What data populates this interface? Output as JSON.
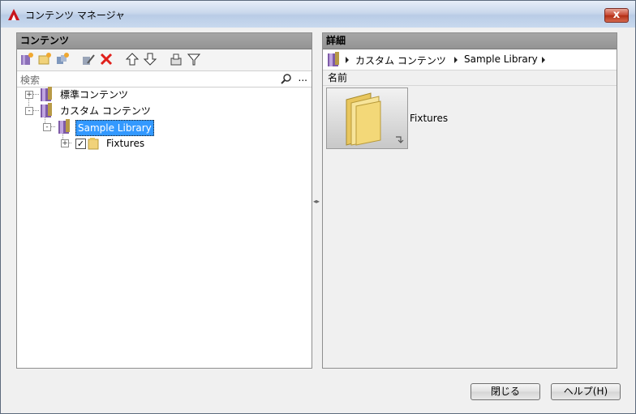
{
  "window": {
    "title": "コンテンツ マネージャ",
    "close_glyph": "x"
  },
  "contents_panel": {
    "header": "コンテンツ",
    "search_placeholder": "検索",
    "search_more": "...",
    "tree": [
      {
        "label": "標準コンテンツ",
        "expander": "+"
      },
      {
        "label": "カスタム コンテンツ",
        "expander": "-"
      },
      {
        "label": "Sample Library",
        "expander": "-"
      },
      {
        "label": "Fixtures",
        "expander": "+",
        "checked": "✓"
      }
    ]
  },
  "details_panel": {
    "header": "詳細",
    "breadcrumb": [
      "カスタム コンテンツ",
      "Sample Library"
    ],
    "column_header": "名前",
    "items": [
      {
        "label": "Fixtures"
      }
    ]
  },
  "buttons": {
    "close": "閉じる",
    "help": "ヘルプ(H)"
  },
  "colors": {
    "selection": "#3399ff",
    "header_gray": "#9c9c9c",
    "delete_red": "#e0201b"
  }
}
